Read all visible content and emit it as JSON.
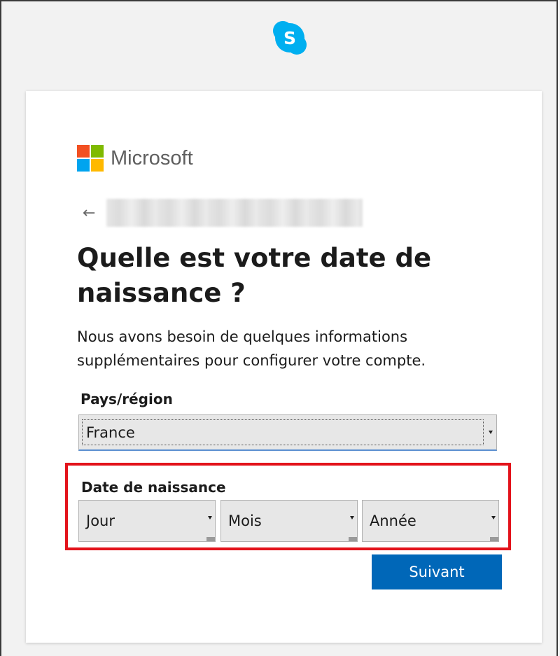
{
  "colors": {
    "skype_blue": "#00aff0",
    "ms_red": "#f25022",
    "ms_green": "#7fba00",
    "ms_blue": "#00a4ef",
    "ms_yellow": "#ffb900",
    "primary_button": "#0067b8",
    "highlight_border": "#e3131b"
  },
  "header": {
    "app_icon": "skype-icon",
    "app_icon_letter": "S"
  },
  "brand": {
    "logo_icon": "microsoft-logo-icon",
    "name": "Microsoft"
  },
  "account": {
    "back_icon": "back-arrow-icon",
    "back_glyph": "←",
    "identifier_blurred": true
  },
  "form": {
    "title": "Quelle est votre date de naissance ?",
    "description": "Nous avons besoin de quelques informations supplémentaires pour configurer votre compte.",
    "country": {
      "label": "Pays/région",
      "selected": "France"
    },
    "birthdate": {
      "label": "Date de naissance",
      "day_placeholder": "Jour",
      "month_placeholder": "Mois",
      "year_placeholder": "Année"
    },
    "next_label": "Suivant"
  }
}
